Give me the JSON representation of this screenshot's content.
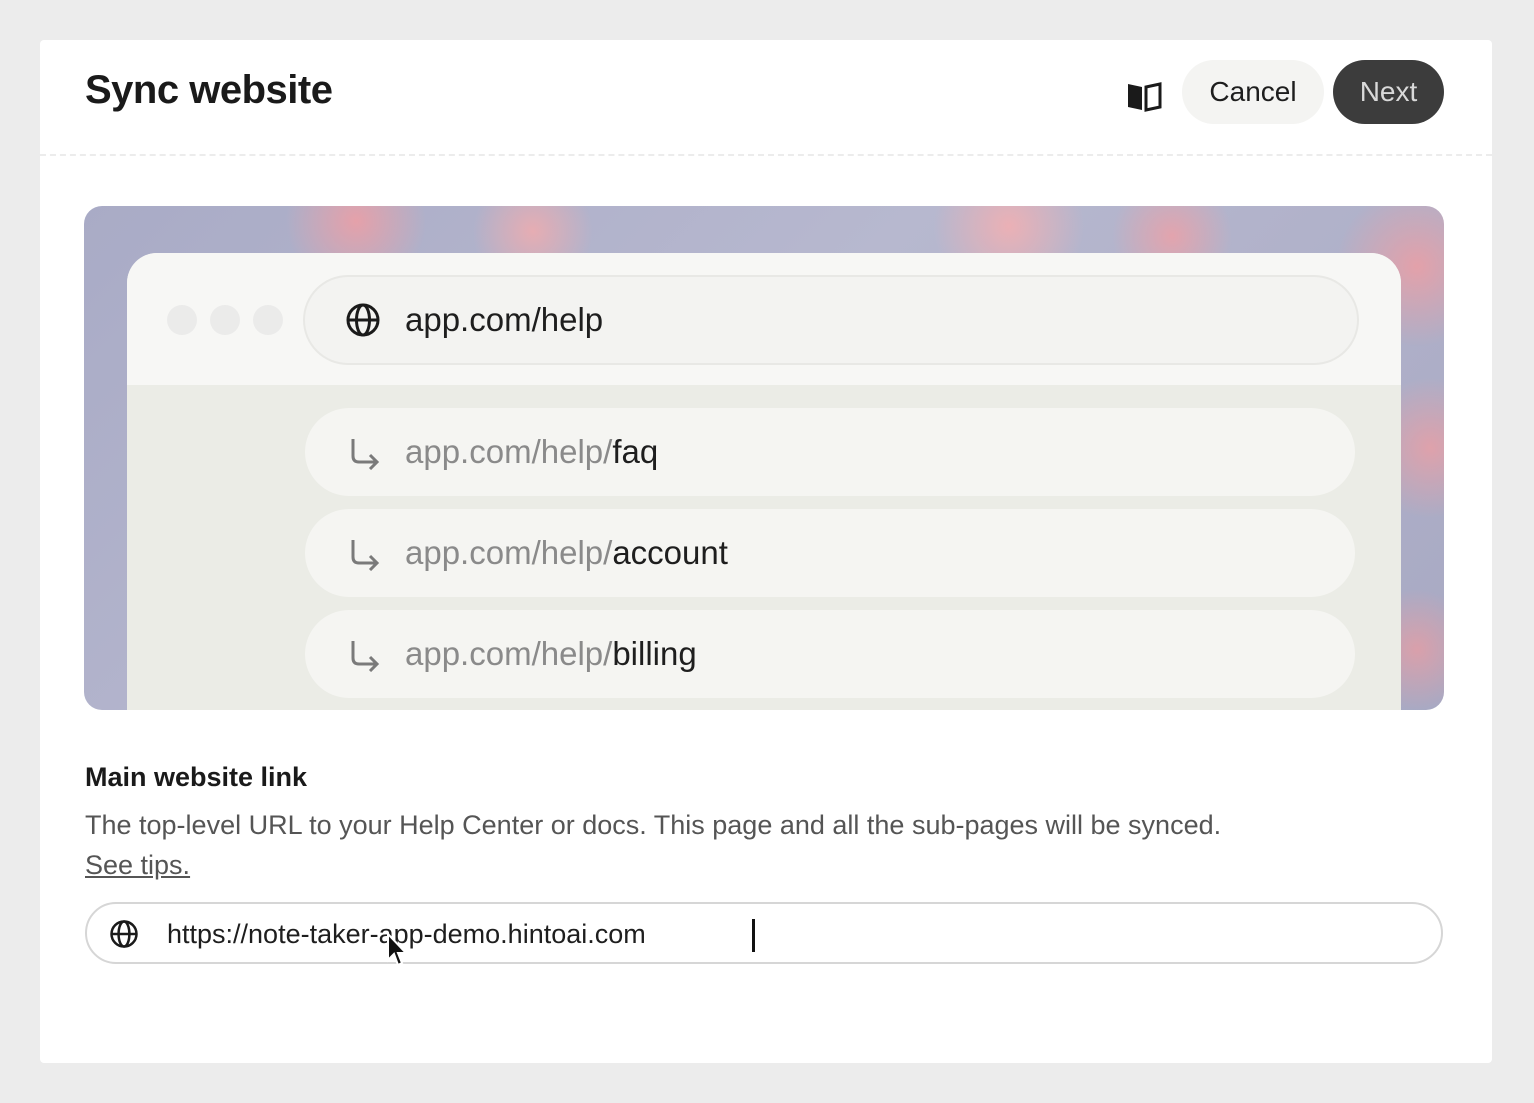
{
  "dialog": {
    "title": "Sync website",
    "actions": {
      "docs_icon": "book-icon",
      "cancel_label": "Cancel",
      "next_label": "Next"
    }
  },
  "preview": {
    "root_url": "app.com/help",
    "sub_pages": [
      {
        "base": "app.com/help/",
        "leaf": "faq"
      },
      {
        "base": "app.com/help/",
        "leaf": "account"
      },
      {
        "base": "app.com/help/",
        "leaf": "billing"
      }
    ]
  },
  "main_link": {
    "label": "Main website link",
    "description": "The top-level URL to your Help Center or docs. This page and all the sub-pages will be synced.",
    "tips_link": "See tips.",
    "input_value": "https://note-taker-app-demo.hintoai.com"
  },
  "colors": {
    "next_button_bg": "#3c3c3c",
    "cancel_button_bg": "#f4f4f2",
    "page_bg": "#ececec"
  }
}
